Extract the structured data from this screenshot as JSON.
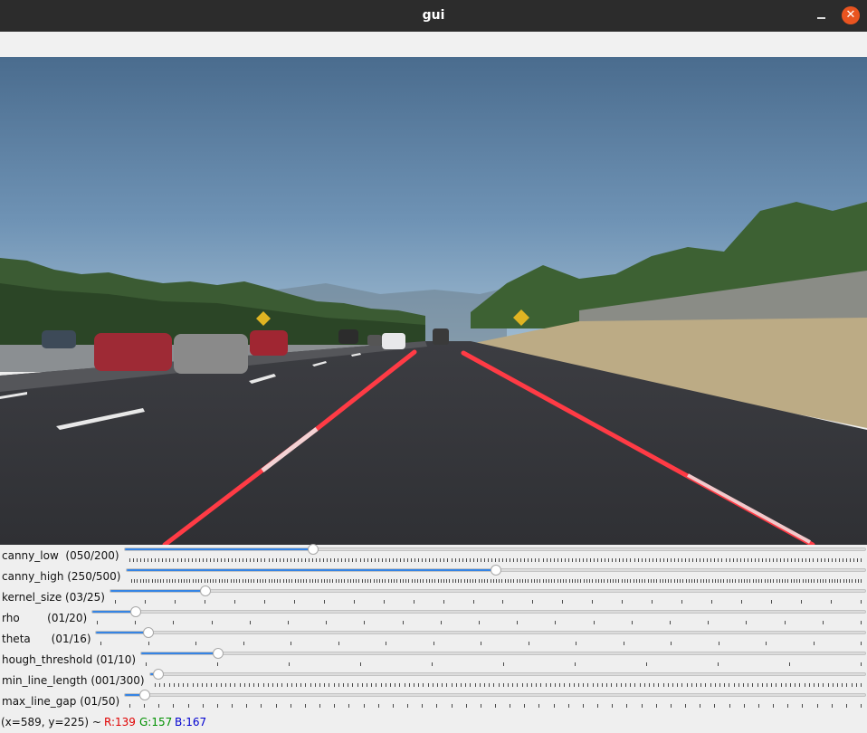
{
  "window": {
    "title": "gui"
  },
  "colors": {
    "titlebar": "#2c2c2c",
    "close": "#e95420",
    "slider_fill": "#3584e4",
    "lane": "#ff3b45",
    "status_r": "#e00000",
    "status_g": "#009000",
    "status_b": "#0000d0"
  },
  "icons": {
    "minimize": "minimize-icon",
    "close": "close-icon"
  },
  "trackbars": [
    {
      "label": "canny_low  (050/200)",
      "value": 50,
      "max": 200
    },
    {
      "label": "canny_high (250/500)",
      "value": 250,
      "max": 500
    },
    {
      "label": "kernel_size (03/25)",
      "value": 3,
      "max": 25
    },
    {
      "label": "rho        (01/20)",
      "value": 1,
      "max": 20
    },
    {
      "label": "theta      (01/16)",
      "value": 1,
      "max": 16
    },
    {
      "label": "hough_threshold (01/10)",
      "value": 1,
      "max": 10
    },
    {
      "label": "min_line_length (001/300)",
      "value": 1,
      "max": 300
    },
    {
      "label": "max_line_gap (01/50)",
      "value": 1,
      "max": 50
    }
  ],
  "status": {
    "coords": "(x=589, y=225) ~",
    "r": "R:139",
    "g": "G:157",
    "b": "B:167"
  }
}
